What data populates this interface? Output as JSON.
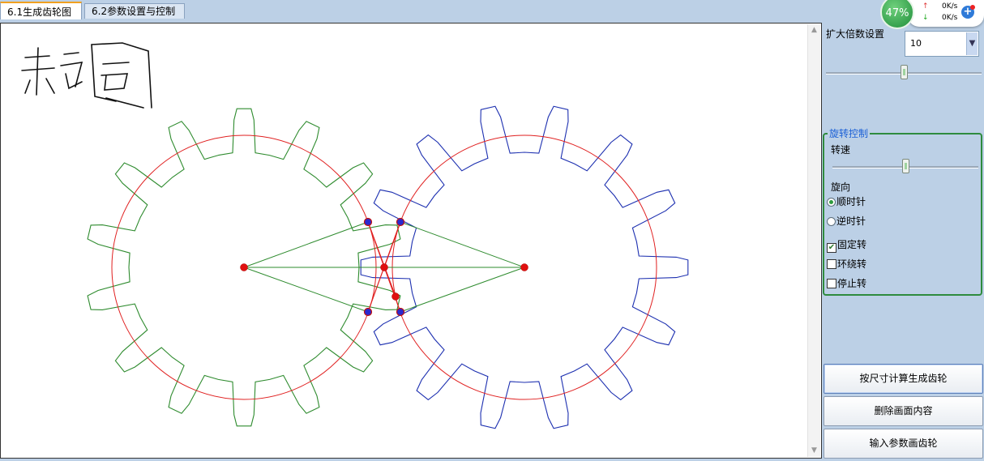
{
  "tabs": [
    {
      "label": "6.1生成齿轮图",
      "active": true
    },
    {
      "label": "6.2参数设置与控制",
      "active": false
    }
  ],
  "canvas": {
    "handwriting": "赤调"
  },
  "panel": {
    "zoom_label": "扩大倍数设置",
    "zoom_value": "10",
    "zoom_slider_fraction": 0.5,
    "rotation_group_title": "旋转控制",
    "speed_label": "转速",
    "speed_slider_fraction": 0.5,
    "direction_label": "旋向",
    "clockwise_label": "顺时针",
    "counterclockwise_label": "逆时针",
    "direction_selected": "clockwise",
    "fixed_rotate_label": "固定转",
    "fixed_rotate_checked": true,
    "orbit_rotate_label": "环绕转",
    "orbit_rotate_checked": false,
    "stop_rotate_label": "停止转",
    "stop_rotate_checked": false,
    "buttons": {
      "calc_generate": "按尺寸计算生成齿轮",
      "clear_canvas": "删除画面内容",
      "input_draw": "输入参数画齿轮"
    }
  },
  "net_widget": {
    "percent": "47%",
    "up_speed": "0K/s",
    "down_speed": "0K/s"
  },
  "colors": {
    "gear_left": "#2e8b2e",
    "gear_right": "#1c2fb0",
    "pitch_circle": "#e02020",
    "accent_group": "#2e8b3e"
  }
}
